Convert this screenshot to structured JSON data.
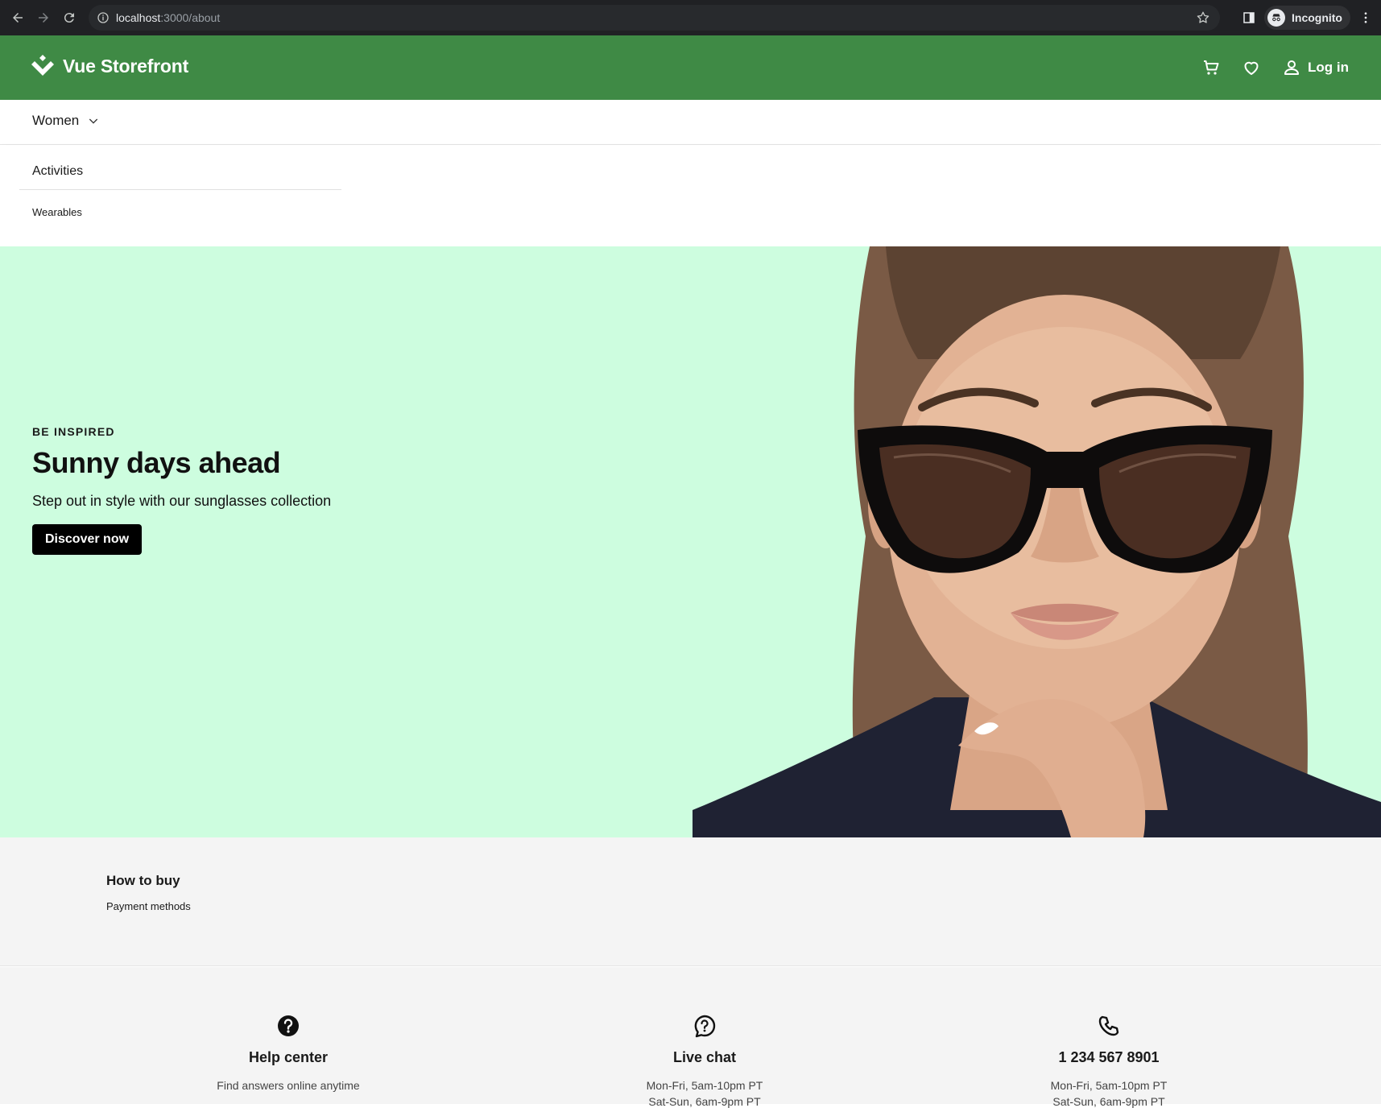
{
  "browser": {
    "url_host": "localhost",
    "url_path": ":3000/about",
    "profile_label": "Incognito"
  },
  "header": {
    "brand": "Vue Storefront",
    "login_label": "Log in",
    "brand_color": "#3f8a45"
  },
  "nav": {
    "category": "Women",
    "menu": {
      "heading": "Activities",
      "items": [
        "Wearables"
      ]
    }
  },
  "hero": {
    "eyebrow": "BE INSPIRED",
    "title": "Sunny days ahead",
    "subtitle": "Step out in style with our sunglasses collection",
    "cta": "Discover now",
    "bg_color": "#cdfddf"
  },
  "footer_links": {
    "heading": "How to buy",
    "items": [
      "Payment methods"
    ]
  },
  "contact": [
    {
      "icon": "help-circle-icon",
      "title": "Help center",
      "line1": "Find answers online anytime",
      "line2": ""
    },
    {
      "icon": "chat-bubble-icon",
      "title": "Live chat",
      "line1": "Mon-Fri, 5am-10pm PT",
      "line2": "Sat-Sun, 6am-9pm PT"
    },
    {
      "icon": "phone-icon",
      "title": "1 234 567 8901",
      "line1": "Mon-Fri, 5am-10pm PT",
      "line2": "Sat-Sun, 6am-9pm PT"
    }
  ]
}
